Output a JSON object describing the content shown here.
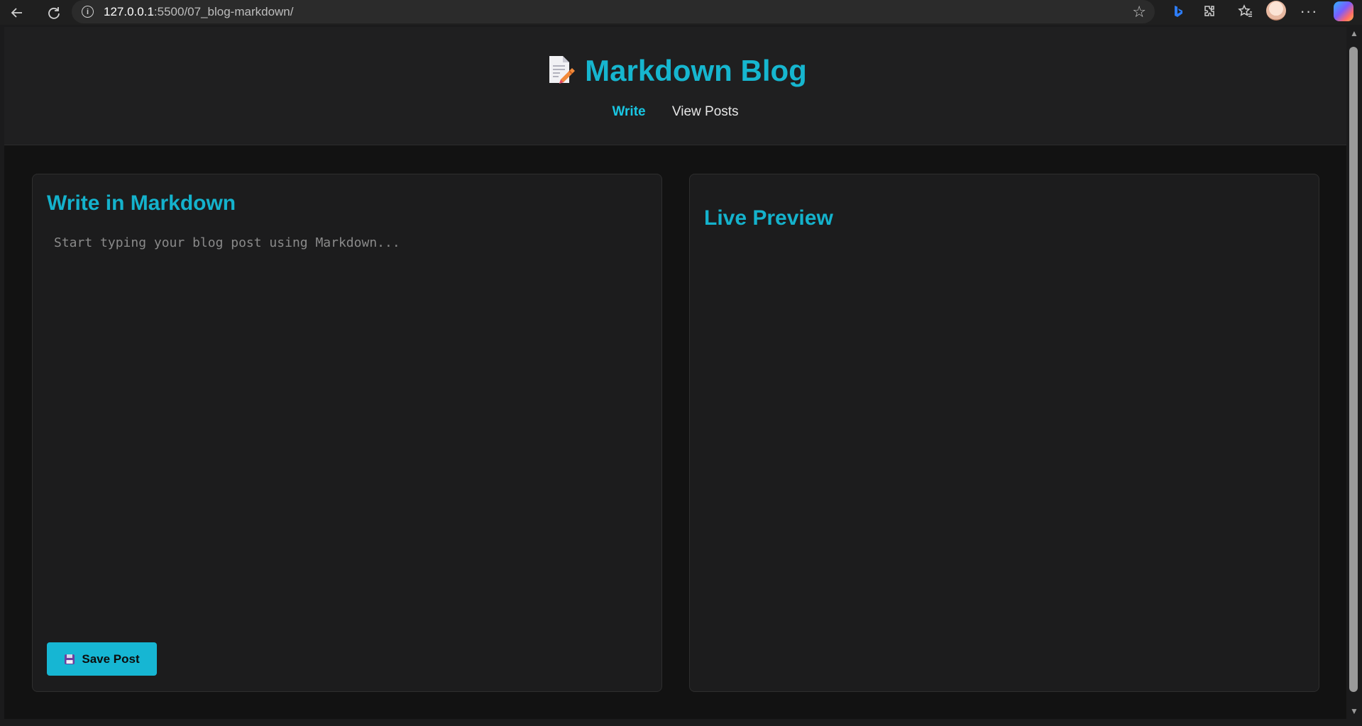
{
  "browser": {
    "url_host": "127.0.0.1",
    "url_path": ":5500/07_blog-markdown/"
  },
  "header": {
    "title": "Markdown Blog",
    "logo_icon": "memo-icon",
    "nav": [
      {
        "label": "Write",
        "active": true
      },
      {
        "label": "View Posts",
        "active": false
      }
    ]
  },
  "editor_panel": {
    "heading": "Write in Markdown",
    "placeholder": "Start typing your blog post using Markdown...",
    "value": "",
    "save_label": "Save Post",
    "save_icon": "floppy-disk-icon"
  },
  "preview_panel": {
    "heading": "Live Preview"
  },
  "colors": {
    "accent": "#16b6cf",
    "background": "#121212",
    "panel": "#1c1c1d",
    "header": "#1f1f20"
  }
}
